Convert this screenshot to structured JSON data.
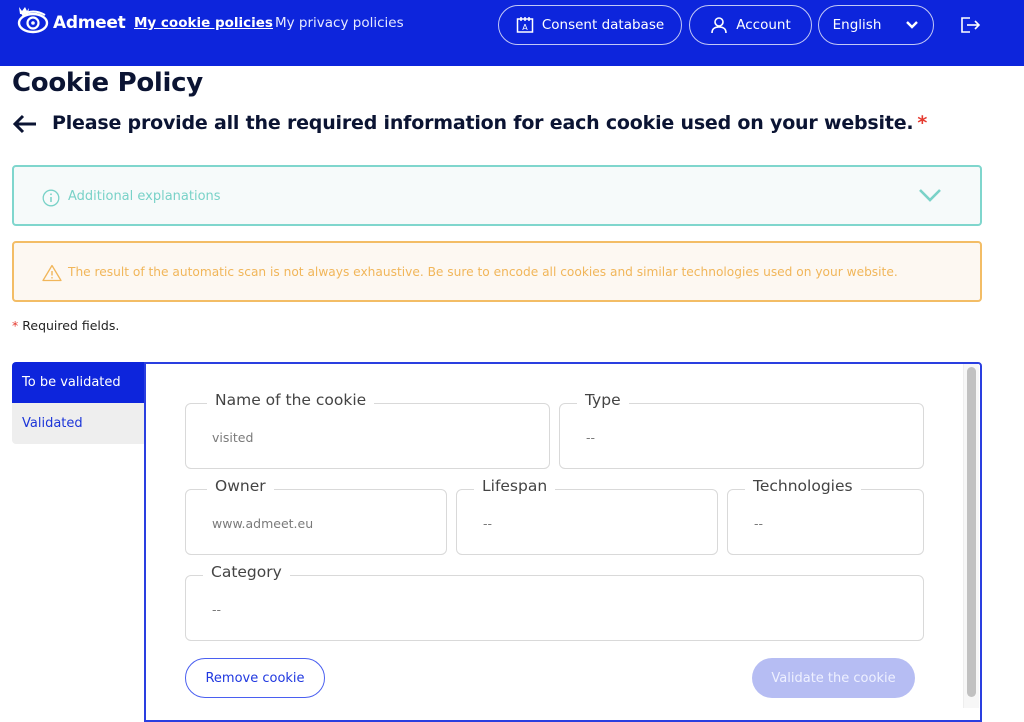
{
  "header": {
    "brand": "Admeet",
    "nav": [
      {
        "label": "My cookie policies",
        "active": true
      },
      {
        "label": "My privacy policies",
        "active": false
      }
    ],
    "consent_database_label": "Consent database",
    "account_label": "Account",
    "language": {
      "selected": "English"
    },
    "icons": {
      "logo": "eye-crown-icon",
      "consent": "calendar-icon",
      "account": "user-icon",
      "language": "chevron-down-icon",
      "logout": "logout-icon"
    },
    "colors": {
      "brand": "#0d25dc"
    }
  },
  "page": {
    "title": "Cookie Policy",
    "subtitle": "Please provide all the required information for each cookie used on your website.",
    "subtitle_required_marker": "*"
  },
  "info_box": {
    "label": "Additional explanations",
    "color": "#7fd6cd"
  },
  "warning_box": {
    "text": "The result of the automatic scan is not always exhaustive. Be sure to encode all cookies and similar technologies used on your website.",
    "color": "#f3bd66"
  },
  "required_note": {
    "marker": "*",
    "text": "Required fields."
  },
  "tabs": [
    {
      "label": "To be validated",
      "active": true
    },
    {
      "label": "Validated",
      "active": false
    }
  ],
  "cookie_form": {
    "fields": {
      "name": {
        "label": "Name of the cookie",
        "value": "visited"
      },
      "type": {
        "label": "Type",
        "value": "--"
      },
      "owner": {
        "label": "Owner",
        "value": "www.admeet.eu"
      },
      "lifespan": {
        "label": "Lifespan",
        "value": "--"
      },
      "technologies": {
        "label": "Technologies",
        "value": "--"
      },
      "category": {
        "label": "Category",
        "value": "--"
      }
    },
    "remove_label": "Remove cookie",
    "validate_label": "Validate the cookie"
  }
}
